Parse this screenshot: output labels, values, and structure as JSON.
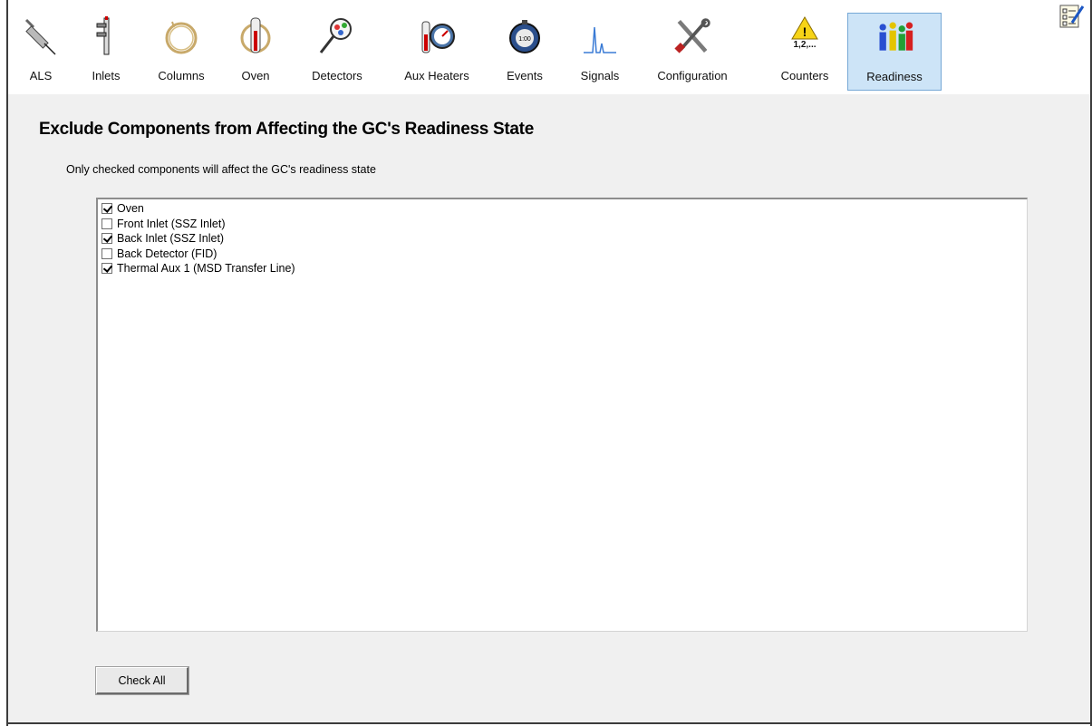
{
  "toolbar": {
    "tabs": [
      {
        "label": "ALS",
        "icon": "syringe-icon"
      },
      {
        "label": "Inlets",
        "icon": "inlet-icon"
      },
      {
        "label": "Columns",
        "icon": "column-coil-icon"
      },
      {
        "label": "Oven",
        "icon": "oven-thermometer-icon"
      },
      {
        "label": "Detectors",
        "icon": "detector-magnifier-icon"
      },
      {
        "label": "Aux Heaters",
        "icon": "gauge-icon"
      },
      {
        "label": "Events",
        "icon": "stopwatch-icon"
      },
      {
        "label": "Signals",
        "icon": "signal-peak-icon"
      },
      {
        "label": "Configuration",
        "icon": "tools-icon"
      },
      {
        "label": "Counters",
        "icon": "warning-counter-icon",
        "counter_text": "1,2,..."
      },
      {
        "label": "Readiness",
        "icon": "readiness-people-icon",
        "selected": true
      }
    ],
    "corner_icon": "checklist-icon"
  },
  "panel": {
    "title": "Exclude Components from Affecting the GC's Readiness State",
    "subtitle": "Only checked components will affect the GC's readiness state",
    "items": [
      {
        "label": "Oven",
        "checked": true
      },
      {
        "label": "Front Inlet (SSZ Inlet)",
        "checked": false
      },
      {
        "label": "Back Inlet (SSZ Inlet)",
        "checked": true
      },
      {
        "label": "Back Detector (FID)",
        "checked": false
      },
      {
        "label": "Thermal Aux 1 (MSD Transfer Line)",
        "checked": true
      }
    ],
    "check_all_label": "Check All"
  }
}
